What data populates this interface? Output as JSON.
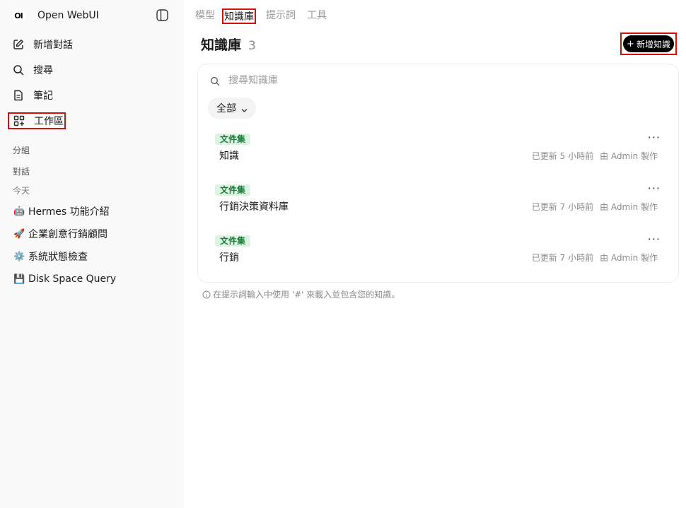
{
  "app": {
    "name": "Open WebUI",
    "logo": "OI"
  },
  "sidebar": {
    "nav": [
      {
        "label": "新增對話",
        "icon": "pencil-square-icon"
      },
      {
        "label": "搜尋",
        "icon": "search-icon"
      },
      {
        "label": "筆記",
        "icon": "note-icon"
      },
      {
        "label": "工作區",
        "icon": "workspace-grid-icon"
      }
    ],
    "sections": {
      "groups": "分組",
      "chats": "對話",
      "today": "今天"
    },
    "chats": [
      {
        "emoji": "🤖",
        "title": "Hermes 功能介紹"
      },
      {
        "emoji": "🚀",
        "title": "企業創意行銷顧問"
      },
      {
        "emoji": "⚙️",
        "title": "系統狀態檢查"
      },
      {
        "emoji": "💾",
        "title": "Disk Space Query"
      }
    ]
  },
  "main": {
    "tabs": [
      {
        "label": "模型"
      },
      {
        "label": "知識庫"
      },
      {
        "label": "提示詞"
      },
      {
        "label": "工具"
      }
    ],
    "title": "知識庫",
    "count": "3",
    "new_button": "新增知識",
    "search_placeholder": "搜尋知識庫",
    "filter": "全部",
    "items": [
      {
        "badge": "文件集",
        "name": "知識",
        "updated": "已更新 5 小時前",
        "by": "由 Admin 製作"
      },
      {
        "badge": "文件集",
        "name": "行銷決策資料庫",
        "updated": "已更新 7 小時前",
        "by": "由 Admin 製作"
      },
      {
        "badge": "文件集",
        "name": "行銷",
        "updated": "已更新 7 小時前",
        "by": "由 Admin 製作"
      }
    ],
    "hint": "在提示詞輸入中使用 '#' 來載入並包含您的知識。"
  },
  "colors": {
    "highlight": "#d10f0f",
    "badge_bg": "#dcf5e3",
    "badge_text": "#1b7a3a",
    "button": "#000000"
  }
}
